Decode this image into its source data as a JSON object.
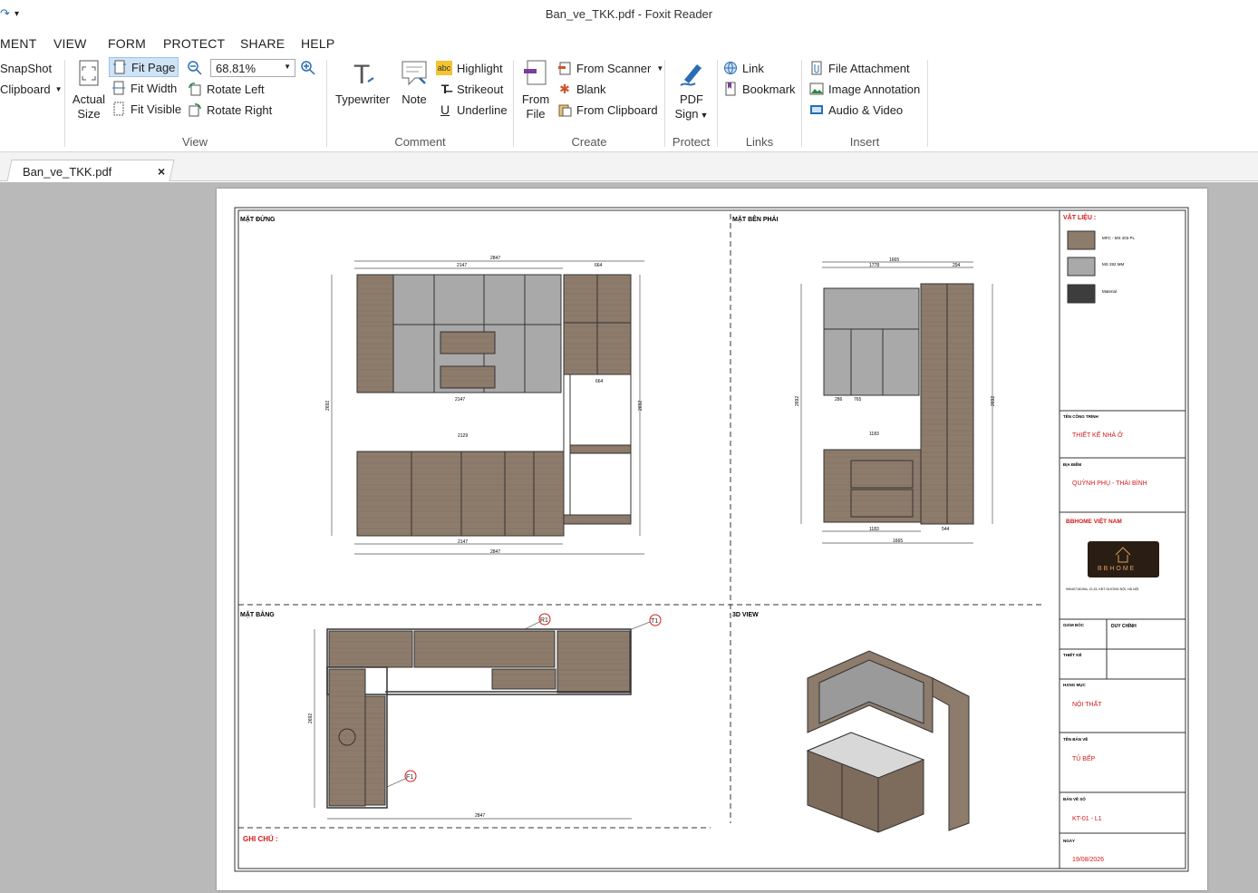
{
  "window": {
    "title": "Ban_ve_TKK.pdf - Foxit Reader"
  },
  "menu": [
    "MENT",
    "VIEW",
    "FORM",
    "PROTECT",
    "SHARE",
    "HELP"
  ],
  "ribbon": {
    "view": {
      "label": "View",
      "snapshot": "SnapShot",
      "clipboard": "Clipboard",
      "actual_size_line1": "Actual",
      "actual_size_line2": "Size",
      "fit_page": "Fit Page",
      "fit_width": "Fit Width",
      "fit_visible": "Fit Visible",
      "zoom_value": "68.81%",
      "rotate_left": "Rotate Left",
      "rotate_right": "Rotate Right"
    },
    "comment": {
      "label": "Comment",
      "typewriter": "Typewriter",
      "note": "Note",
      "highlight": "Highlight",
      "strikeout": "Strikeout",
      "underline": "Underline",
      "abc": "abc"
    },
    "create": {
      "label": "Create",
      "from_file_line1": "From",
      "from_file_line2": "File",
      "from_scanner": "From Scanner",
      "blank": "Blank",
      "from_clipboard": "From Clipboard"
    },
    "protect": {
      "label": "Protect",
      "pdf_sign_line1": "PDF",
      "pdf_sign_line2": "Sign"
    },
    "links": {
      "label": "Links",
      "link": "Link",
      "bookmark": "Bookmark"
    },
    "insert": {
      "label": "Insert",
      "file_attachment": "File Attachment",
      "image_annotation": "Image Annotation",
      "audio_video": "Audio & Video"
    }
  },
  "tab": {
    "label": "Ban_ve_TKK.pdf",
    "close": "×"
  },
  "drawing": {
    "sec_front": "MẶT ĐỨNG",
    "sec_side": "MẶT BÊN PHẢI",
    "sec_plan": "MẶT BẰNG",
    "sec_3d": "3D VIEW",
    "notes": "GHI CHÚ :",
    "dims": {
      "d2847": "2847",
      "d2147": "2147",
      "d664": "664",
      "d2129": "2129",
      "d1665": "1665",
      "d1183": "1183",
      "d2692": "2692",
      "d544": "544",
      "d1778": "1778",
      "d294": "294",
      "d765": "765",
      "d286": "286"
    },
    "callouts": {
      "r1": "R1",
      "t1": "T1",
      "f1": "F1"
    },
    "title_block": {
      "materials_heading": "VẬT LIỆU :",
      "material1": "MFC - MS 403 PL",
      "material2": "MS 282 MM",
      "material3": "Material",
      "project_label": "TÊN CÔNG TRÌNH",
      "project_value": "THIẾT KẾ NHÀ Ở",
      "location_label": "ĐỊA ĐIỂM",
      "location_value": "QUỲNH PHỤ - THÁI BÌNH",
      "company": "BBHOME VIỆT NAM",
      "logo_text": "BBHOME",
      "company_contact": "0904071819hs, CL33, KĐT DƯƠNG NỘI, HÀ NỘI",
      "director_label": "GIÁM ĐỐC",
      "director_value": "DUY CHÍNH",
      "designer_label": "THIẾT KẾ",
      "category_label": "HẠNG MỤC",
      "category_value": "NỘI THẤT",
      "drawing_name_label": "TÊN BẢN VẼ",
      "drawing_name_value": "TỦ BẾP",
      "drawing_no_label": "BẢN VẼ SỐ",
      "drawing_no_value": "KT-01 - L1",
      "date_label": "NGÀY",
      "date_value": "19/08/2026"
    }
  },
  "colors": {
    "wood": "#8d7b6b",
    "wood_light": "#a59483",
    "gray_cab": "#a9a9a9",
    "dark": "#3d3d3d",
    "red_text": "#d21a1a",
    "viewer_bg": "#b9b9b9"
  }
}
